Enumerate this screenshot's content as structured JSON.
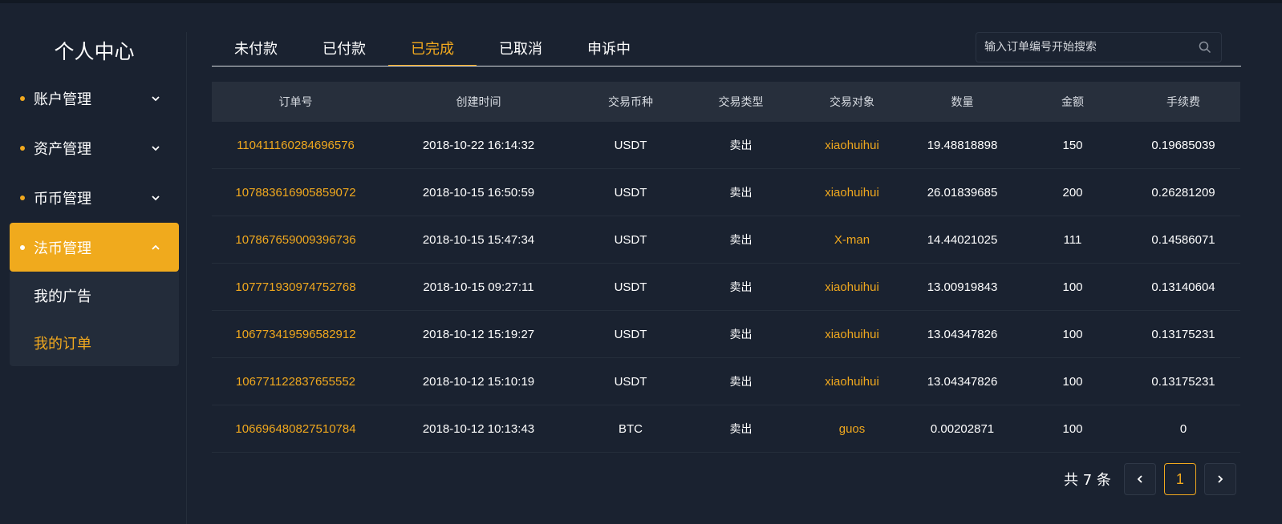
{
  "sidebar": {
    "title": "个人中心",
    "items": [
      {
        "label": "账户管理"
      },
      {
        "label": "资产管理"
      },
      {
        "label": "币币管理"
      },
      {
        "label": "法币管理"
      }
    ],
    "submenu": [
      {
        "label": "我的广告"
      },
      {
        "label": "我的订单"
      }
    ]
  },
  "tabs": [
    {
      "label": "未付款"
    },
    {
      "label": "已付款"
    },
    {
      "label": "已完成"
    },
    {
      "label": "已取消"
    },
    {
      "label": "申诉中"
    }
  ],
  "active_tab": "已完成",
  "search": {
    "placeholder": "输入订单编号开始搜索",
    "value": ""
  },
  "table": {
    "headers": [
      "订单号",
      "创建时间",
      "交易币种",
      "交易类型",
      "交易对象",
      "数量",
      "金额",
      "手续费"
    ],
    "rows": [
      [
        "110411160284696576",
        "2018-10-22 16:14:32",
        "USDT",
        "卖出",
        "xiaohuihui",
        "19.48818898",
        "150",
        "0.19685039"
      ],
      [
        "107883616905859072",
        "2018-10-15 16:50:59",
        "USDT",
        "卖出",
        "xiaohuihui",
        "26.01839685",
        "200",
        "0.26281209"
      ],
      [
        "107867659009396736",
        "2018-10-15 15:47:34",
        "USDT",
        "卖出",
        "X-man",
        "14.44021025",
        "111",
        "0.14586071"
      ],
      [
        "107771930974752768",
        "2018-10-15 09:27:11",
        "USDT",
        "卖出",
        "xiaohuihui",
        "13.00919843",
        "100",
        "0.13140604"
      ],
      [
        "106773419596582912",
        "2018-10-12 15:19:27",
        "USDT",
        "卖出",
        "xiaohuihui",
        "13.04347826",
        "100",
        "0.13175231"
      ],
      [
        "106771122837655552",
        "2018-10-12 15:10:19",
        "USDT",
        "卖出",
        "xiaohuihui",
        "13.04347826",
        "100",
        "0.13175231"
      ],
      [
        "106696480827510784",
        "2018-10-12 10:13:43",
        "BTC",
        "卖出",
        "guos",
        "0.00202871",
        "100",
        "0"
      ]
    ]
  },
  "pagination": {
    "total": "共 7 条",
    "current_page": "1",
    "prev_icon": "chevron-left-icon",
    "next_icon": "chevron-right-icon"
  },
  "colors": {
    "accent": "#f0a81e",
    "background": "#1a2230",
    "header": "#272f3c"
  }
}
